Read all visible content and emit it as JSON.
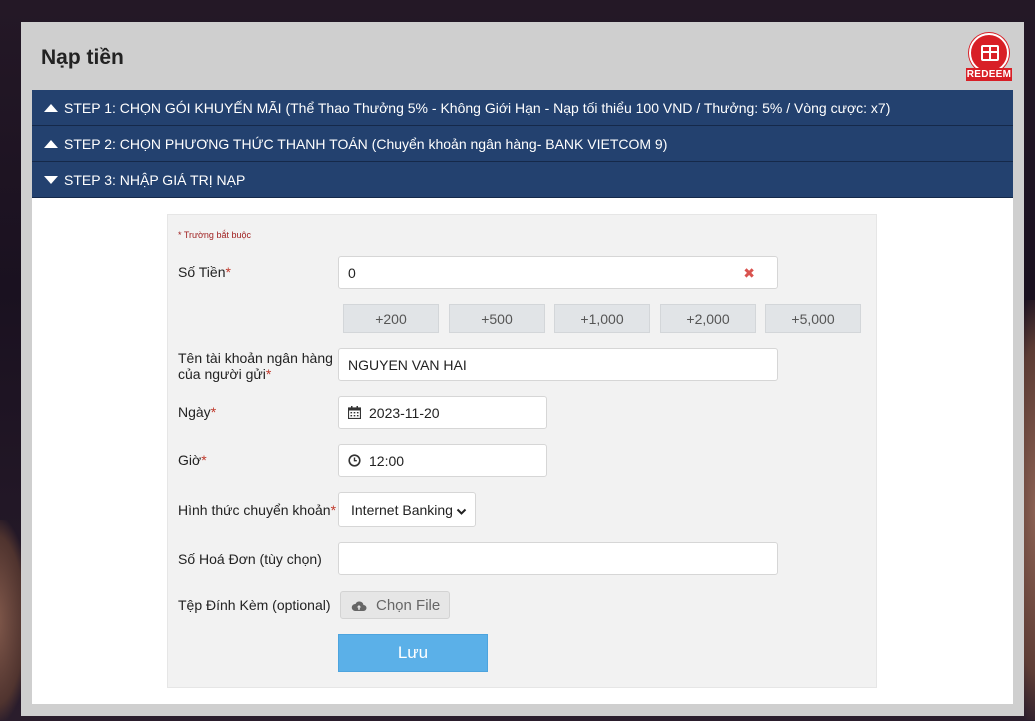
{
  "panel": {
    "title": "Nạp tiền",
    "redeem_label": "REDEEM"
  },
  "steps": [
    {
      "label": "STEP 1: CHỌN GÓI KHUYẾN MÃI (Thể Thao Thưởng 5% - Không Giới Hạn - Nạp tối thiểu 100 VND / Thưởng: 5% / Vòng cược: x7)",
      "state": "collapsed"
    },
    {
      "label": "STEP 2: CHỌN PHƯƠNG THỨC THANH TOÁN (Chuyển khoản ngân hàng- BANK VIETCOM 9)",
      "state": "collapsed"
    },
    {
      "label": "STEP 3: NHẬP GIÁ TRỊ NẠP",
      "state": "expanded"
    }
  ],
  "form": {
    "required_note": "* Trường bắt buộc",
    "amount": {
      "label": "Số Tiền",
      "value": "0"
    },
    "quick_amounts": [
      "+200",
      "+500",
      "+1,000",
      "+2,000",
      "+5,000"
    ],
    "account_name": {
      "label_line1": "Tên tài khoản ngân hàng",
      "label_line2": "của người gửi",
      "value": "NGUYEN VAN HAI"
    },
    "date": {
      "label": "Ngày",
      "value": "2023-11-20"
    },
    "time": {
      "label": "Giờ",
      "value": "12:00"
    },
    "transfer_method": {
      "label": "Hình thức chuyển khoản",
      "value": "Internet Banking"
    },
    "invoice": {
      "label": "Số Hoá Đơn (tùy chọn)",
      "value": ""
    },
    "attachment": {
      "label": "Tệp Đính Kèm (optional)",
      "button": "Chọn File"
    },
    "save_label": "Lưu"
  },
  "colors": {
    "step_bar": "#23416f",
    "save_button": "#5bb0e8",
    "required": "#c0392b",
    "redeem": "#d81f26"
  },
  "icons": [
    "caret-up-icon",
    "caret-down-icon",
    "gift-icon",
    "clear-icon",
    "calendar-icon",
    "clock-icon",
    "chevron-down-icon",
    "cloud-upload-icon"
  ]
}
